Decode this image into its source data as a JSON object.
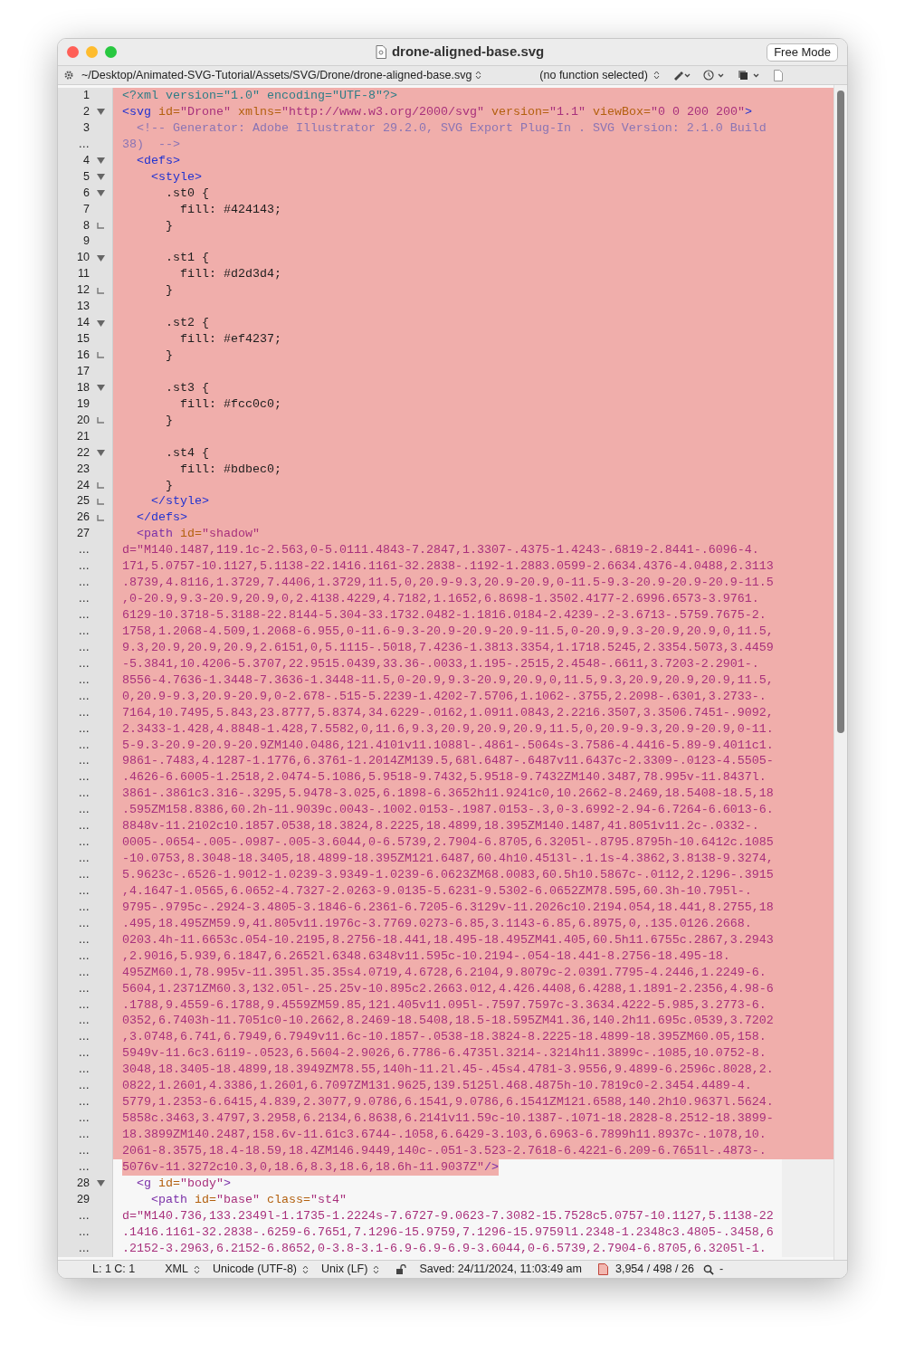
{
  "window": {
    "title": "drone-aligned-base.svg",
    "mode_button": "Free Mode"
  },
  "path_bar": {
    "path": "~/Desktop/Animated-SVG-Tutorial/Assets/SVG/Drone/drone-aligned-base.svg",
    "function_menu": "(no function selected)"
  },
  "rows": [
    {
      "gutter": "1",
      "selected": true,
      "tokens": [
        {
          "kind": "pi",
          "text": "<?xml version=\"1.0\" encoding=\"UTF-8\"?>"
        }
      ]
    },
    {
      "gutter": "2",
      "fold_start": true,
      "selected": true,
      "tokens": [
        {
          "kind": "tag",
          "text": "<svg"
        },
        {
          "kind": "attr",
          "text": " id="
        },
        {
          "kind": "value",
          "text": "\"Drone\""
        },
        {
          "kind": "attr",
          "text": " xmlns="
        },
        {
          "kind": "value",
          "text": "\"http://www.w3.org/2000/svg\""
        },
        {
          "kind": "attr",
          "text": " version="
        },
        {
          "kind": "value",
          "text": "\"1.1\""
        },
        {
          "kind": "attr",
          "text": " viewBox="
        },
        {
          "kind": "value",
          "text": "\"0 0 200 200\""
        },
        {
          "kind": "tag",
          "text": ">"
        }
      ]
    },
    {
      "gutter": "3",
      "selected": true,
      "tokens": [
        {
          "kind": "comment",
          "text": "  <!-- Generator: Adobe Illustrator 29.2.0, SVG Export Plug-In . SVG Version: 2.1.0 Build"
        }
      ]
    },
    {
      "gutter": "…",
      "selected": true,
      "tokens": [
        {
          "kind": "comment",
          "text": "38)  -->"
        }
      ]
    },
    {
      "gutter": "4",
      "fold_start": true,
      "selected": true,
      "tokens": [
        {
          "kind": "tag",
          "text": "  <defs>"
        }
      ]
    },
    {
      "gutter": "5",
      "fold_start": true,
      "selected": true,
      "tokens": [
        {
          "kind": "tag",
          "text": "    <style>"
        }
      ]
    },
    {
      "gutter": "6",
      "fold_start": true,
      "selected": true,
      "tokens": [
        {
          "kind": "css",
          "text": "      .st0 {"
        }
      ]
    },
    {
      "gutter": "7",
      "selected": true,
      "tokens": [
        {
          "kind": "css",
          "text": "        fill: #424143;"
        }
      ]
    },
    {
      "gutter": "8",
      "fold_end": true,
      "selected": true,
      "tokens": [
        {
          "kind": "css",
          "text": "      }"
        }
      ]
    },
    {
      "gutter": "9",
      "selected": true
    },
    {
      "gutter": "10",
      "fold_start": true,
      "selected": true,
      "tokens": [
        {
          "kind": "css",
          "text": "      .st1 {"
        }
      ]
    },
    {
      "gutter": "11",
      "selected": true,
      "tokens": [
        {
          "kind": "css",
          "text": "        fill: #d2d3d4;"
        }
      ]
    },
    {
      "gutter": "12",
      "fold_end": true,
      "selected": true,
      "tokens": [
        {
          "kind": "css",
          "text": "      }"
        }
      ]
    },
    {
      "gutter": "13",
      "selected": true
    },
    {
      "gutter": "14",
      "fold_start": true,
      "selected": true,
      "tokens": [
        {
          "kind": "css",
          "text": "      .st2 {"
        }
      ]
    },
    {
      "gutter": "15",
      "selected": true,
      "tokens": [
        {
          "kind": "css",
          "text": "        fill: #ef4237;"
        }
      ]
    },
    {
      "gutter": "16",
      "fold_end": true,
      "selected": true,
      "tokens": [
        {
          "kind": "css",
          "text": "      }"
        }
      ]
    },
    {
      "gutter": "17",
      "selected": true
    },
    {
      "gutter": "18",
      "fold_start": true,
      "selected": true,
      "tokens": [
        {
          "kind": "css",
          "text": "      .st3 {"
        }
      ]
    },
    {
      "gutter": "19",
      "selected": true,
      "tokens": [
        {
          "kind": "css",
          "text": "        fill: #fcc0c0;"
        }
      ]
    },
    {
      "gutter": "20",
      "fold_end": true,
      "selected": true,
      "tokens": [
        {
          "kind": "css",
          "text": "      }"
        }
      ]
    },
    {
      "gutter": "21",
      "selected": true
    },
    {
      "gutter": "22",
      "fold_start": true,
      "selected": true,
      "tokens": [
        {
          "kind": "css",
          "text": "      .st4 {"
        }
      ]
    },
    {
      "gutter": "23",
      "selected": true,
      "tokens": [
        {
          "kind": "css",
          "text": "        fill: #bdbec0;"
        }
      ]
    },
    {
      "gutter": "24",
      "fold_end": true,
      "selected": true,
      "tokens": [
        {
          "kind": "css",
          "text": "      }"
        }
      ]
    },
    {
      "gutter": "25",
      "fold_end": true,
      "selected": true,
      "tokens": [
        {
          "kind": "tag",
          "text": "    </style>"
        }
      ]
    },
    {
      "gutter": "26",
      "fold_end": true,
      "selected": true,
      "tokens": [
        {
          "kind": "tag",
          "text": "  </defs>"
        }
      ]
    },
    {
      "gutter": "27",
      "selected": true,
      "tokens": [
        {
          "kind": "element",
          "text": "  <path"
        },
        {
          "kind": "attr",
          "text": " id="
        },
        {
          "kind": "value",
          "text": "\"shadow\""
        }
      ]
    },
    {
      "gutter": "…",
      "selected": true,
      "tokens": [
        {
          "kind": "value",
          "text": "d=\"M140.1487,119.1c-2.563,0-5.0111.4843-7.2847,1.3307-.4375-1.4243-.6819-2.8441-.6096-4."
        }
      ]
    },
    {
      "gutter": "…",
      "selected": true,
      "tokens": [
        {
          "kind": "value",
          "text": "171,5.0757-10.1127,5.1138-22.1416.1161-32.2838-.1192-1.2883.0599-2.6634.4376-4.0488,2.3113"
        }
      ]
    },
    {
      "gutter": "…",
      "selected": true,
      "tokens": [
        {
          "kind": "value",
          "text": ".8739,4.8116,1.3729,7.4406,1.3729,11.5,0,20.9-9.3,20.9-20.9,0-11.5-9.3-20.9-20.9-20.9-11.5"
        }
      ]
    },
    {
      "gutter": "…",
      "selected": true,
      "tokens": [
        {
          "kind": "value",
          "text": ",0-20.9,9.3-20.9,20.9,0,2.4138.4229,4.7182,1.1652,6.8698-1.3502.4177-2.6996.6573-3.9761."
        }
      ]
    },
    {
      "gutter": "…",
      "selected": true,
      "tokens": [
        {
          "kind": "value",
          "text": "6129-10.3718-5.3188-22.8144-5.304-33.1732.0482-1.1816.0184-2.4239-.2-3.6713-.5759.7675-2."
        }
      ]
    },
    {
      "gutter": "…",
      "selected": true,
      "tokens": [
        {
          "kind": "value",
          "text": "1758,1.2068-4.509,1.2068-6.955,0-11.6-9.3-20.9-20.9-20.9-11.5,0-20.9,9.3-20.9,20.9,0,11.5,"
        }
      ]
    },
    {
      "gutter": "…",
      "selected": true,
      "tokens": [
        {
          "kind": "value",
          "text": "9.3,20.9,20.9,20.9,2.6151,0,5.1115-.5018,7.4236-1.3813.3354,1.1718.5245,2.3354.5073,3.4459"
        }
      ]
    },
    {
      "gutter": "…",
      "selected": true,
      "tokens": [
        {
          "kind": "value",
          "text": "-5.3841,10.4206-5.3707,22.9515.0439,33.36-.0033,1.195-.2515,2.4548-.6611,3.7203-2.2901-."
        }
      ]
    },
    {
      "gutter": "…",
      "selected": true,
      "tokens": [
        {
          "kind": "value",
          "text": "8556-4.7636-1.3448-7.3636-1.3448-11.5,0-20.9,9.3-20.9,20.9,0,11.5,9.3,20.9,20.9,20.9,11.5,"
        }
      ]
    },
    {
      "gutter": "…",
      "selected": true,
      "tokens": [
        {
          "kind": "value",
          "text": "0,20.9-9.3,20.9-20.9,0-2.678-.515-5.2239-1.4202-7.5706,1.1062-.3755,2.2098-.6301,3.2733-."
        }
      ]
    },
    {
      "gutter": "…",
      "selected": true,
      "tokens": [
        {
          "kind": "value",
          "text": "7164,10.7495,5.843,23.8777,5.8374,34.6229-.0162,1.0911.0843,2.2216.3507,3.3506.7451-.9092,"
        }
      ]
    },
    {
      "gutter": "…",
      "selected": true,
      "tokens": [
        {
          "kind": "value",
          "text": "2.3433-1.428,4.8848-1.428,7.5582,0,11.6,9.3,20.9,20.9,20.9,11.5,0,20.9-9.3,20.9-20.9,0-11."
        }
      ]
    },
    {
      "gutter": "…",
      "selected": true,
      "tokens": [
        {
          "kind": "value",
          "text": "5-9.3-20.9-20.9-20.9ZM140.0486,121.4101v11.1088l-.4861-.5064s-3.7586-4.4416-5.89-9.4011c1."
        }
      ]
    },
    {
      "gutter": "…",
      "selected": true,
      "tokens": [
        {
          "kind": "value",
          "text": "9861-.7483,4.1287-1.1776,6.3761-1.2014ZM139.5,68l.6487-.6487v11.6437c-2.3309-.0123-4.5505-"
        }
      ]
    },
    {
      "gutter": "…",
      "selected": true,
      "tokens": [
        {
          "kind": "value",
          "text": ".4626-6.6005-1.2518,2.0474-5.1086,5.9518-9.7432,5.9518-9.7432ZM140.3487,78.995v-11.8437l."
        }
      ]
    },
    {
      "gutter": "…",
      "selected": true,
      "tokens": [
        {
          "kind": "value",
          "text": "3861-.3861c3.316-.3295,5.9478-3.025,6.1898-6.3652h11.9241c0,10.2662-8.2469,18.5408-18.5,18"
        }
      ]
    },
    {
      "gutter": "…",
      "selected": true,
      "tokens": [
        {
          "kind": "value",
          "text": ".595ZM158.8386,60.2h-11.9039c.0043-.1002.0153-.1987.0153-.3,0-3.6992-2.94-6.7264-6.6013-6."
        }
      ]
    },
    {
      "gutter": "…",
      "selected": true,
      "tokens": [
        {
          "kind": "value",
          "text": "8848v-11.2102c10.1857.0538,18.3824,8.2225,18.4899,18.395ZM140.1487,41.8051v11.2c-.0332-."
        }
      ]
    },
    {
      "gutter": "…",
      "selected": true,
      "tokens": [
        {
          "kind": "value",
          "text": "0005-.0654-.005-.0987-.005-3.6044,0-6.5739,2.7904-6.8705,6.3205l-.8795.8795h-10.6412c.1085"
        }
      ]
    },
    {
      "gutter": "…",
      "selected": true,
      "tokens": [
        {
          "kind": "value",
          "text": "-10.0753,8.3048-18.3405,18.4899-18.395ZM121.6487,60.4h10.4513l-.1.1s-4.3862,3.8138-9.3274,"
        }
      ]
    },
    {
      "gutter": "…",
      "selected": true,
      "tokens": [
        {
          "kind": "value",
          "text": "5.9623c-.6526-1.9012-1.0239-3.9349-1.0239-6.0623ZM68.0083,60.5h10.5867c-.0112,2.1296-.3915"
        }
      ]
    },
    {
      "gutter": "…",
      "selected": true,
      "tokens": [
        {
          "kind": "value",
          "text": ",4.1647-1.0565,6.0652-4.7327-2.0263-9.0135-5.6231-9.5302-6.0652ZM78.595,60.3h-10.795l-."
        }
      ]
    },
    {
      "gutter": "…",
      "selected": true,
      "tokens": [
        {
          "kind": "value",
          "text": "9795-.9795c-.2924-3.4805-3.1846-6.2361-6.7205-6.3129v-11.2026c10.2194.054,18.441,8.2755,18"
        }
      ]
    },
    {
      "gutter": "…",
      "selected": true,
      "tokens": [
        {
          "kind": "value",
          "text": ".495,18.495ZM59.9,41.805v11.1976c-3.7769.0273-6.85,3.1143-6.85,6.8975,0,.135.0126.2668."
        }
      ]
    },
    {
      "gutter": "…",
      "selected": true,
      "tokens": [
        {
          "kind": "value",
          "text": "0203.4h-11.6653c.054-10.2195,8.2756-18.441,18.495-18.495ZM41.405,60.5h11.6755c.2867,3.2943"
        }
      ]
    },
    {
      "gutter": "…",
      "selected": true,
      "tokens": [
        {
          "kind": "value",
          "text": ",2.9016,5.939,6.1847,6.2652l.6348.6348v11.595c-10.2194-.054-18.441-8.2756-18.495-18."
        }
      ]
    },
    {
      "gutter": "…",
      "selected": true,
      "tokens": [
        {
          "kind": "value",
          "text": "495ZM60.1,78.995v-11.395l.35.35s4.0719,4.6728,6.2104,9.8079c-2.0391.7795-4.2446,1.2249-6."
        }
      ]
    },
    {
      "gutter": "…",
      "selected": true,
      "tokens": [
        {
          "kind": "value",
          "text": "5604,1.2371ZM60.3,132.05l-.25.25v-10.895c2.2663.012,4.426.4408,6.4288,1.1891-2.2356,4.98-6"
        }
      ]
    },
    {
      "gutter": "…",
      "selected": true,
      "tokens": [
        {
          "kind": "value",
          "text": ".1788,9.4559-6.1788,9.4559ZM59.85,121.405v11.095l-.7597.7597c-3.3634.4222-5.985,3.2773-6."
        }
      ]
    },
    {
      "gutter": "…",
      "selected": true,
      "tokens": [
        {
          "kind": "value",
          "text": "0352,6.7403h-11.7051c0-10.2662,8.2469-18.5408,18.5-18.595ZM41.36,140.2h11.695c.0539,3.7202"
        }
      ]
    },
    {
      "gutter": "…",
      "selected": true,
      "tokens": [
        {
          "kind": "value",
          "text": ",3.0748,6.741,6.7949,6.7949v11.6c-10.1857-.0538-18.3824-8.2225-18.4899-18.395ZM60.05,158."
        }
      ]
    },
    {
      "gutter": "…",
      "selected": true,
      "tokens": [
        {
          "kind": "value",
          "text": "5949v-11.6c3.6119-.0523,6.5604-2.9026,6.7786-6.4735l.3214-.3214h11.3899c-.1085,10.0752-8."
        }
      ]
    },
    {
      "gutter": "…",
      "selected": true,
      "tokens": [
        {
          "kind": "value",
          "text": "3048,18.3405-18.4899,18.3949ZM78.55,140h-11.2l.45-.45s4.4781-3.9556,9.4899-6.2596c.8028,2."
        }
      ]
    },
    {
      "gutter": "…",
      "selected": true,
      "tokens": [
        {
          "kind": "value",
          "text": "0822,1.2601,4.3386,1.2601,6.7097ZM131.9625,139.5125l.468.4875h-10.7819c0-2.3454.4489-4."
        }
      ]
    },
    {
      "gutter": "…",
      "selected": true,
      "tokens": [
        {
          "kind": "value",
          "text": "5779,1.2353-6.6415,4.839,2.3077,9.0786,6.1541,9.0786,6.1541ZM121.6588,140.2h10.9637l.5624."
        }
      ]
    },
    {
      "gutter": "…",
      "selected": true,
      "tokens": [
        {
          "kind": "value",
          "text": "5858c.3463,3.4797,3.2958,6.2134,6.8638,6.2141v11.59c-10.1387-.1071-18.2828-8.2512-18.3899-"
        }
      ]
    },
    {
      "gutter": "…",
      "selected": true,
      "tokens": [
        {
          "kind": "value",
          "text": "18.3899ZM140.2487,158.6v-11.61c3.6744-.1058,6.6429-3.103,6.6963-6.7899h11.8937c-.1078,10."
        }
      ]
    },
    {
      "gutter": "…",
      "selected": true,
      "tokens": [
        {
          "kind": "value",
          "text": "2061-8.3575,18.4-18.59,18.4ZM146.9449,140c-.051-3.523-2.7618-6.4221-6.209-6.7651l-.4873-."
        }
      ]
    },
    {
      "gutter": "…",
      "selected": true,
      "tokens": [
        {
          "kind": "value",
          "text": "5076v-11.3272c10.3,0,18.6,8.3,18.6,18.6h-11.9037Z\""
        },
        {
          "kind": "element",
          "text": "/>"
        }
      ]
    },
    {
      "gutter": "28",
      "fold_start": true,
      "selected": false,
      "tokens": [
        {
          "kind": "element",
          "text": "  <g"
        },
        {
          "kind": "attr",
          "text": " id="
        },
        {
          "kind": "value",
          "text": "\"body\""
        },
        {
          "kind": "element",
          "text": ">"
        }
      ]
    },
    {
      "gutter": "29",
      "selected": false,
      "tokens": [
        {
          "kind": "element",
          "text": "    <path"
        },
        {
          "kind": "attr",
          "text": " id="
        },
        {
          "kind": "value",
          "text": "\"base\""
        },
        {
          "kind": "attr",
          "text": " class="
        },
        {
          "kind": "value",
          "text": "\"st4\""
        }
      ]
    },
    {
      "gutter": "…",
      "selected": false,
      "tokens": [
        {
          "kind": "value",
          "text": "d=\"M140.736,133.2349l-1.1735-1.2224s-7.6727-9.0623-7.3082-15.7528c5.0757-10.1127,5.1138-22"
        }
      ]
    },
    {
      "gutter": "…",
      "selected": false,
      "tokens": [
        {
          "kind": "value",
          "text": ".1416.1161-32.2838-.6259-6.7651,7.1296-15.9759,7.1296-15.9759l1.2348-1.2348c3.4805-.3458,6"
        }
      ]
    },
    {
      "gutter": "…",
      "selected": false,
      "tokens": [
        {
          "kind": "value",
          "text": ".2152-3.2963,6.2152-6.8652,0-3.8-3.1-6.9-6.9-6.9-3.6044,0-6.5739,2.7904-6.8705,6.3205l-1."
        }
      ]
    }
  ],
  "status_bar": {
    "position": "L: 1 C: 1",
    "syntax": "XML",
    "encoding": "Unicode (UTF-8)",
    "line_endings": "Unix (LF)",
    "saved": "Saved: 24/11/2024, 11:03:49 am",
    "counts": "3,954 / 498 / 26",
    "search_menu": "-"
  }
}
